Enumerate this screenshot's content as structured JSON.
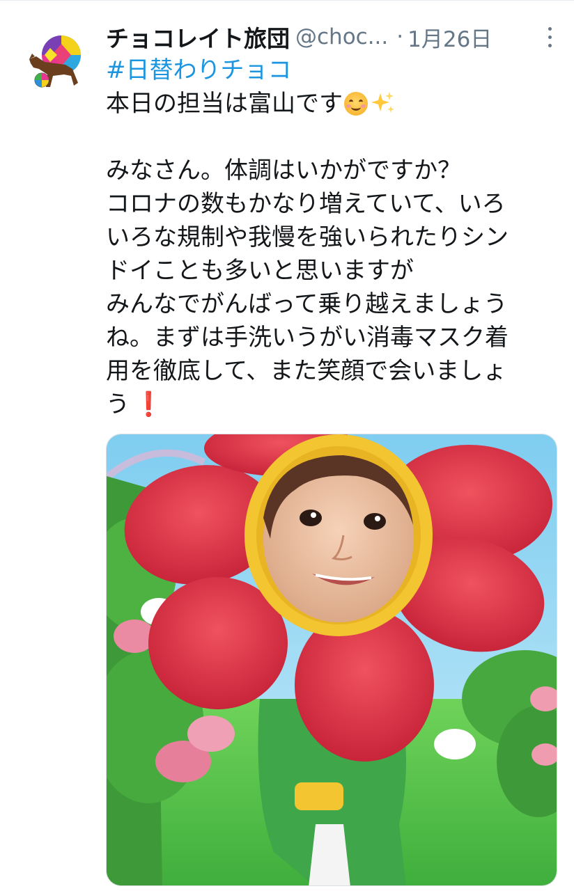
{
  "tweet": {
    "display_name": "チョコレイト旅団",
    "handle": "@choc...",
    "separator": "·",
    "timestamp": "1月26日",
    "more_icon": "more-vertical-icon",
    "hashtag": "#日替わりチョコ",
    "intro": "本日の担当は富山です",
    "intro_emojis": [
      "smiling-face-icon",
      "sparkles-icon"
    ],
    "paragraph_lines": [
      "みなさん。体調はいかがですか？",
      "コロナの数もかなり増えていて、いろ",
      "いろな規制や我慢を強いられたりシン",
      "ドイことも多いと思いますが",
      "みんなでがんばって乗り越えましょう",
      "ね。まずは手洗いうがい消毒マスク着",
      "用を徹底して、また笑顔で会いましょ"
    ],
    "last_line": "う",
    "last_emoji": "❗",
    "media_description_icon": "flower-costume-photo"
  },
  "colors": {
    "text": "#14171a",
    "secondary": "#657786",
    "link": "#1b95e0",
    "petal": "#e23a4a",
    "face_ring": "#f2c531",
    "suit": "#3fa64a",
    "sky": "#8fd3f2",
    "grass": "#5cc14d"
  }
}
